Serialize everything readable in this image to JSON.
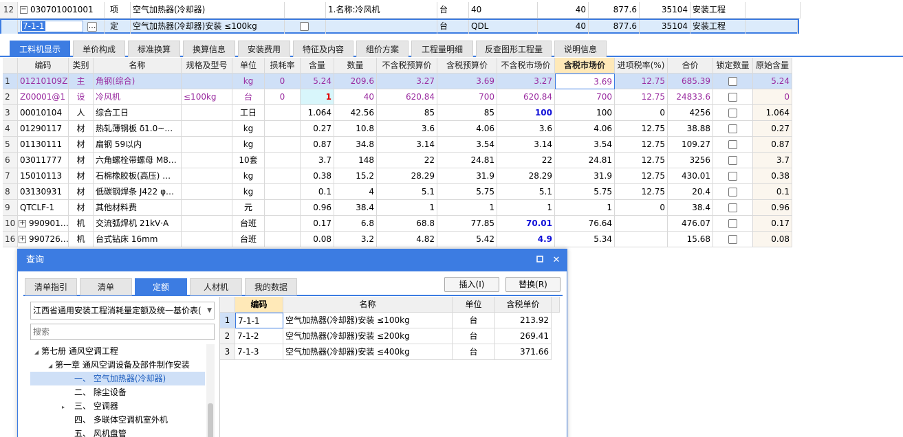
{
  "top_rows": [
    {
      "row_num": "12",
      "code": "030701001001",
      "type": "项",
      "name": "空气加热器(冷却器)",
      "feature": "1.名称:冷风机",
      "unit": "台",
      "qty_expr": "40",
      "qty": "40",
      "price": "877.6",
      "total": "35104",
      "category": "安装工程"
    },
    {
      "row_num": "",
      "code": "7-1-1",
      "type": "定",
      "name": "空气加热器(冷却器)安装 ≤100kg",
      "feature": "",
      "unit": "台",
      "qty_expr": "QDL",
      "qty": "40",
      "price": "877.6",
      "total": "35104",
      "category": "安装工程"
    }
  ],
  "tabs": [
    "工料机显示",
    "单价构成",
    "标准换算",
    "换算信息",
    "安装费用",
    "特征及内容",
    "组价方案",
    "工程量明细",
    "反查图形工程量",
    "说明信息"
  ],
  "grid": {
    "headers": [
      "编码",
      "类别",
      "名称",
      "规格及型号",
      "单位",
      "损耗率",
      "含量",
      "数量",
      "不含税预算价",
      "含税预算价",
      "不含税市场价",
      "含税市场价",
      "进项税率(%)",
      "合价",
      "锁定数量",
      "原始含量"
    ],
    "rows": [
      {
        "rn": "1",
        "code": "01210109Z",
        "type": "主",
        "name": "角钢(综合)",
        "spec": "",
        "unit": "kg",
        "loss": "0",
        "content": "5.24",
        "qty": "209.6",
        "p1": "3.27",
        "p2": "3.69",
        "p3": "3.27",
        "p4": "3.69",
        "tax": "12.75",
        "total": "685.39",
        "orig": "5.24"
      },
      {
        "rn": "2",
        "code": "Z00001@1",
        "type": "设",
        "name": "冷风机",
        "spec": "≤100kg",
        "unit": "台",
        "loss": "0",
        "content": "1",
        "qty": "40",
        "p1": "620.84",
        "p2": "700",
        "p3": "620.84",
        "p4": "700",
        "tax": "12.75",
        "total": "24833.6",
        "orig": "0"
      },
      {
        "rn": "3",
        "code": "00010104",
        "type": "人",
        "name": "综合工日",
        "spec": "",
        "unit": "工日",
        "loss": "",
        "content": "1.064",
        "qty": "42.56",
        "p1": "85",
        "p2": "85",
        "p3": "100",
        "p4": "100",
        "tax": "0",
        "total": "4256",
        "orig": "1.064"
      },
      {
        "rn": "4",
        "code": "01290117",
        "type": "材",
        "name": "热轧薄钢板 δ1.0~…",
        "spec": "",
        "unit": "kg",
        "loss": "",
        "content": "0.27",
        "qty": "10.8",
        "p1": "3.6",
        "p2": "4.06",
        "p3": "3.6",
        "p4": "4.06",
        "tax": "12.75",
        "total": "38.88",
        "orig": "0.27"
      },
      {
        "rn": "5",
        "code": "01130111",
        "type": "材",
        "name": "扁钢 59以内",
        "spec": "",
        "unit": "kg",
        "loss": "",
        "content": "0.87",
        "qty": "34.8",
        "p1": "3.14",
        "p2": "3.54",
        "p3": "3.14",
        "p4": "3.54",
        "tax": "12.75",
        "total": "109.27",
        "orig": "0.87"
      },
      {
        "rn": "6",
        "code": "03011777",
        "type": "材",
        "name": "六角螺栓带螺母 M8…",
        "spec": "",
        "unit": "10套",
        "loss": "",
        "content": "3.7",
        "qty": "148",
        "p1": "22",
        "p2": "24.81",
        "p3": "22",
        "p4": "24.81",
        "tax": "12.75",
        "total": "3256",
        "orig": "3.7"
      },
      {
        "rn": "7",
        "code": "15010113",
        "type": "材",
        "name": "石棉橡胶板(高压) …",
        "spec": "",
        "unit": "kg",
        "loss": "",
        "content": "0.38",
        "qty": "15.2",
        "p1": "28.29",
        "p2": "31.9",
        "p3": "28.29",
        "p4": "31.9",
        "tax": "12.75",
        "total": "430.01",
        "orig": "0.38"
      },
      {
        "rn": "8",
        "code": "03130931",
        "type": "材",
        "name": "低碳钢焊条 J422 φ…",
        "spec": "",
        "unit": "kg",
        "loss": "",
        "content": "0.1",
        "qty": "4",
        "p1": "5.1",
        "p2": "5.75",
        "p3": "5.1",
        "p4": "5.75",
        "tax": "12.75",
        "total": "20.4",
        "orig": "0.1"
      },
      {
        "rn": "9",
        "code": "QTCLF-1",
        "type": "材",
        "name": "其他材料费",
        "spec": "",
        "unit": "元",
        "loss": "",
        "content": "0.96",
        "qty": "38.4",
        "p1": "1",
        "p2": "1",
        "p3": "1",
        "p4": "1",
        "tax": "0",
        "total": "38.4",
        "orig": "0.96"
      },
      {
        "rn": "10",
        "code": "990901…",
        "type": "机",
        "name": "交流弧焊机 21kV·A",
        "spec": "",
        "unit": "台班",
        "loss": "",
        "content": "0.17",
        "qty": "6.8",
        "p1": "68.8",
        "p2": "77.85",
        "p3": "70.01",
        "p4": "76.64",
        "tax": "",
        "total": "476.07",
        "orig": "0.17"
      },
      {
        "rn": "16",
        "code": "990726…",
        "type": "机",
        "name": "台式钻床 16mm",
        "spec": "",
        "unit": "台班",
        "loss": "",
        "content": "0.08",
        "qty": "3.2",
        "p1": "4.82",
        "p2": "5.42",
        "p3": "4.9",
        "p4": "5.34",
        "tax": "",
        "total": "15.68",
        "orig": "0.08"
      }
    ]
  },
  "dialog": {
    "title": "查询",
    "tabs": [
      "清单指引",
      "清单",
      "定额",
      "人材机",
      "我的数据"
    ],
    "insert_label": "插入(I)",
    "replace_label": "替换(R)",
    "library": "江西省通用安装工程消耗量定额及统一基价表(",
    "search_placeholder": "搜索",
    "tree": [
      {
        "label": "第七册 通风空调工程"
      },
      {
        "label": "第一章 通风空调设备及部件制作安装"
      },
      {
        "label": "一、 空气加热器(冷却器)"
      },
      {
        "label": "二、 除尘设备"
      },
      {
        "label": "三、 空调器"
      },
      {
        "label": "四、 多联体空调机室外机"
      },
      {
        "label": "五、 风机盘管"
      }
    ],
    "result_headers": [
      "编码",
      "名称",
      "单位",
      "含税单价"
    ],
    "results": [
      {
        "rn": "1",
        "code": "7-1-1",
        "name": "空气加热器(冷却器)安装 ≤100kg",
        "unit": "台",
        "price": "213.92"
      },
      {
        "rn": "2",
        "code": "7-1-2",
        "name": "空气加热器(冷却器)安装 ≤200kg",
        "unit": "台",
        "price": "269.41"
      },
      {
        "rn": "3",
        "code": "7-1-3",
        "name": "空气加热器(冷却器)安装 ≤400kg",
        "unit": "台",
        "price": "371.66"
      }
    ]
  }
}
